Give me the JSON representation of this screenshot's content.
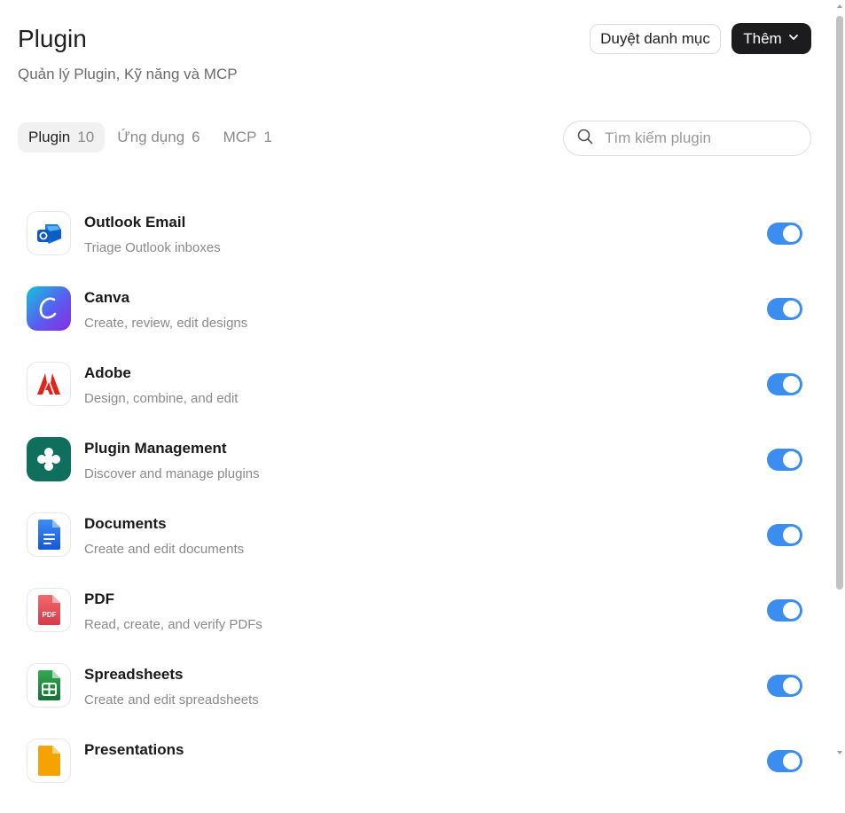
{
  "header": {
    "title": "Plugin",
    "subtitle": "Quản lý Plugin, Kỹ năng và MCP",
    "browse_label": "Duyệt danh mục",
    "more_label": "Thêm"
  },
  "tabs": [
    {
      "label": "Plugin",
      "count": "10"
    },
    {
      "label": "Ứng dụng",
      "count": "6"
    },
    {
      "label": "MCP",
      "count": "1"
    }
  ],
  "search": {
    "placeholder": "Tìm kiếm plugin",
    "value": ""
  },
  "plugins": [
    {
      "name": "Outlook Email",
      "description": "Triage Outlook inboxes",
      "icon": "outlook-icon",
      "enabled": true
    },
    {
      "name": "Canva",
      "description": "Create, review, edit designs",
      "icon": "canva-icon",
      "enabled": true
    },
    {
      "name": "Adobe",
      "description": "Design, combine, and edit",
      "icon": "adobe-icon",
      "enabled": true
    },
    {
      "name": "Plugin Management",
      "description": "Discover and manage plugins",
      "icon": "plugin-management-icon",
      "enabled": true
    },
    {
      "name": "Documents",
      "description": "Create and edit documents",
      "icon": "documents-icon",
      "enabled": true
    },
    {
      "name": "PDF",
      "description": "Read, create, and verify PDFs",
      "icon": "pdf-icon",
      "icon_text": "PDF",
      "enabled": true
    },
    {
      "name": "Spreadsheets",
      "description": "Create and edit spreadsheets",
      "icon": "spreadsheets-icon",
      "enabled": true
    },
    {
      "name": "Presentations",
      "description": "",
      "icon": "presentations-icon",
      "enabled": true
    }
  ],
  "colors": {
    "toggle_on": "#3b8ef0",
    "primary_button": "#1c1c1e",
    "canva": "#7b3fe4",
    "adobe": "#e1251b",
    "plugin_management": "#0f6e5c",
    "documents": "#1a73e8",
    "pdf": "#e84a4a",
    "spreadsheets": "#1e8e3e",
    "presentations": "#f4a300"
  }
}
